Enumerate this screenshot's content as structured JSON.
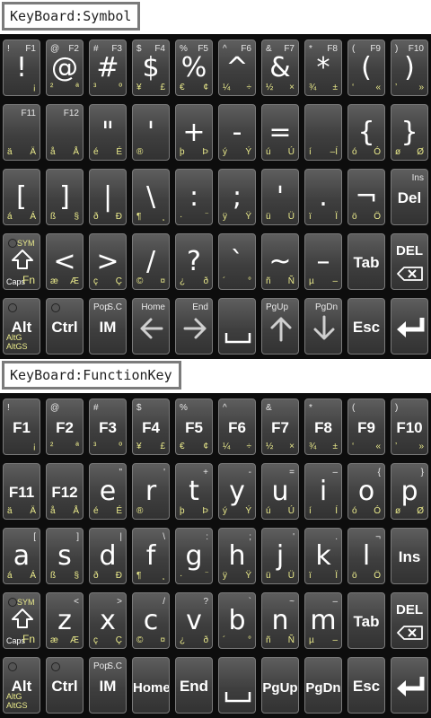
{
  "captions": {
    "symbol": "KeyBoard:Symbol",
    "function": "KeyBoard:FunctionKey"
  },
  "symbol_keyboard": {
    "row1": [
      {
        "tl": "!",
        "tr": "F1",
        "main": "!",
        "bl": "",
        "br": "¡"
      },
      {
        "tl": "@",
        "tr": "F2",
        "main": "@",
        "bl": "²",
        "br": "ª"
      },
      {
        "tl": "#",
        "tr": "F3",
        "main": "#",
        "bl": "³",
        "br": "º"
      },
      {
        "tl": "$",
        "tr": "F4",
        "main": "$",
        "bl": "¥",
        "br": "£"
      },
      {
        "tl": "%",
        "tr": "F5",
        "main": "%",
        "bl": "€",
        "br": "¢"
      },
      {
        "tl": "^",
        "tr": "F6",
        "main": "^",
        "bl": "¼",
        "br": "÷"
      },
      {
        "tl": "&",
        "tr": "F7",
        "main": "&",
        "bl": "½",
        "br": "×"
      },
      {
        "tl": "*",
        "tr": "F8",
        "main": "*",
        "bl": "¾",
        "br": "±"
      },
      {
        "tl": "(",
        "tr": "F9",
        "main": "(",
        "bl": "‘",
        "br": "«"
      },
      {
        "tl": ")",
        "tr": "F10",
        "main": ")",
        "bl": "’",
        "br": "»"
      }
    ],
    "row2": [
      {
        "tl": "",
        "tr": "F11",
        "main": "",
        "bl": "ä",
        "br": "Ä"
      },
      {
        "tl": "",
        "tr": "F12",
        "main": "",
        "bl": "å",
        "br": "Å"
      },
      {
        "tl": "",
        "tr": "",
        "main": "\"",
        "bl": "é",
        "br": "É"
      },
      {
        "tl": "",
        "tr": "",
        "main": "'",
        "bl": "®",
        "br": ""
      },
      {
        "tl": "",
        "tr": "",
        "main": "+",
        "bl": "þ",
        "br": "Þ"
      },
      {
        "tl": "",
        "tr": "",
        "main": "-",
        "bl": "ý",
        "br": "Ý"
      },
      {
        "tl": "",
        "tr": "",
        "main": "=",
        "bl": "ú",
        "br": "Ú"
      },
      {
        "tl": "",
        "tr": "",
        "main": "",
        "bl": "í",
        "br": "–Í"
      },
      {
        "tl": "",
        "tr": "",
        "main": "{",
        "bl": "ó",
        "br": "Ó"
      },
      {
        "tl": "",
        "tr": "",
        "main": "}",
        "bl": "ø",
        "br": "Ø"
      }
    ],
    "row3": [
      {
        "tl": "",
        "tr": "",
        "main": "[",
        "bl": "á",
        "br": "Á"
      },
      {
        "tl": "",
        "tr": "",
        "main": "]",
        "bl": "ß",
        "br": "§"
      },
      {
        "tl": "",
        "tr": "",
        "main": "|",
        "bl": "ð",
        "br": "Ð"
      },
      {
        "tl": "",
        "tr": "",
        "main": "\\",
        "bl": "¶",
        "br": "¸"
      },
      {
        "tl": "",
        "tr": "",
        "main": ":",
        "bl": "·",
        "br": "¨"
      },
      {
        "tl": "",
        "tr": "",
        "main": ";",
        "bl": "ÿ",
        "br": "Ÿ"
      },
      {
        "tl": "",
        "tr": "",
        "main": "'",
        "bl": "ü",
        "br": "Ü"
      },
      {
        "tl": "",
        "tr": "",
        "main": ".",
        "bl": "ï",
        "br": "Ï"
      },
      {
        "tl": "",
        "tr": "",
        "main": "¬",
        "bl": "ö",
        "br": "Ö"
      },
      {
        "tl": "",
        "tr": "Ins",
        "main": "Del",
        "bl": "",
        "br": "",
        "word": true
      }
    ],
    "row4": [
      {
        "shift": true,
        "sym": "SYM",
        "caps": "Caps",
        "fn": "Fn"
      },
      {
        "tl": "",
        "tr": "",
        "main": "<",
        "bl": "æ",
        "br": "Æ"
      },
      {
        "tl": "",
        "tr": "",
        "main": ">",
        "bl": "ç",
        "br": "Ç"
      },
      {
        "tl": "",
        "tr": "",
        "main": "/",
        "bl": "©",
        "br": "¤"
      },
      {
        "tl": "",
        "tr": "",
        "main": "?",
        "bl": "¿",
        "br": "ð"
      },
      {
        "tl": "",
        "tr": "",
        "main": "`",
        "bl": "´",
        "br": "°"
      },
      {
        "tl": "",
        "tr": "",
        "main": "~",
        "bl": "ñ",
        "br": "Ñ"
      },
      {
        "tl": "",
        "tr": "",
        "main": "–",
        "bl": "µ",
        "br": "–"
      },
      {
        "tl": "",
        "tr": "",
        "main": "Tab",
        "bl": "",
        "br": "",
        "word": true
      },
      {
        "del_icon": true,
        "main": "DEL"
      }
    ],
    "row5": [
      {
        "main": "Alt",
        "word": true,
        "led": true,
        "altg": "AltG AltGS"
      },
      {
        "main": "Ctrl",
        "word": true,
        "led": true
      },
      {
        "main": "IM",
        "word": true,
        "tl": "Pop",
        "tr": "S.C"
      },
      {
        "arrow": "left",
        "tr": "Home"
      },
      {
        "arrow": "right",
        "tr": "End"
      },
      {
        "space": true
      },
      {
        "arrow": "up",
        "tl": "PgUp"
      },
      {
        "arrow": "down",
        "tr": "PgDn"
      },
      {
        "main": "Esc",
        "word": true
      },
      {
        "enter": true
      }
    ]
  },
  "function_keyboard": {
    "row1": [
      {
        "tl": "!",
        "tr": "",
        "main": "F1",
        "bl": "",
        "br": "¡",
        "word": true
      },
      {
        "tl": "@",
        "tr": "",
        "main": "F2",
        "bl": "²",
        "br": "ª",
        "word": true
      },
      {
        "tl": "#",
        "tr": "",
        "main": "F3",
        "bl": "³",
        "br": "º",
        "word": true
      },
      {
        "tl": "$",
        "tr": "",
        "main": "F4",
        "bl": "¥",
        "br": "£",
        "word": true
      },
      {
        "tl": "%",
        "tr": "",
        "main": "F5",
        "bl": "€",
        "br": "¢",
        "word": true
      },
      {
        "tl": "^",
        "tr": "",
        "main": "F6",
        "bl": "¼",
        "br": "÷",
        "word": true
      },
      {
        "tl": "&",
        "tr": "",
        "main": "F7",
        "bl": "½",
        "br": "×",
        "word": true
      },
      {
        "tl": "*",
        "tr": "",
        "main": "F8",
        "bl": "¾",
        "br": "±",
        "word": true
      },
      {
        "tl": "(",
        "tr": "",
        "main": "F9",
        "bl": "‘",
        "br": "«",
        "word": true
      },
      {
        "tl": ")",
        "tr": "",
        "main": "F10",
        "bl": "’",
        "br": "»",
        "word": true
      }
    ],
    "row2": [
      {
        "tl": "",
        "tr": "",
        "main": "F11",
        "bl": "ä",
        "br": "Ä",
        "word": true
      },
      {
        "tl": "",
        "tr": "",
        "main": "F12",
        "bl": "å",
        "br": "Å",
        "word": true
      },
      {
        "tl": "",
        "tr": "\"",
        "main": "e",
        "bl": "é",
        "br": "É"
      },
      {
        "tl": "",
        "tr": "'",
        "main": "r",
        "bl": "®",
        "br": ""
      },
      {
        "tl": "",
        "tr": "+",
        "main": "t",
        "bl": "þ",
        "br": "Þ"
      },
      {
        "tl": "",
        "tr": "-",
        "main": "y",
        "bl": "ý",
        "br": "Ý"
      },
      {
        "tl": "",
        "tr": "=",
        "main": "u",
        "bl": "ú",
        "br": "Ú"
      },
      {
        "tl": "",
        "tr": "–",
        "main": "i",
        "bl": "í",
        "br": "Í"
      },
      {
        "tl": "",
        "tr": "{",
        "main": "o",
        "bl": "ó",
        "br": "Ó"
      },
      {
        "tl": "",
        "tr": "}",
        "main": "p",
        "bl": "ø",
        "br": "Ø"
      }
    ],
    "row3": [
      {
        "tl": "",
        "tr": "[",
        "main": "a",
        "bl": "á",
        "br": "Á"
      },
      {
        "tl": "",
        "tr": "]",
        "main": "s",
        "bl": "ß",
        "br": "§"
      },
      {
        "tl": "",
        "tr": "|",
        "main": "d",
        "bl": "ð",
        "br": "Ð"
      },
      {
        "tl": "",
        "tr": "\\",
        "main": "f",
        "bl": "¶",
        "br": "¸"
      },
      {
        "tl": "",
        "tr": ":",
        "main": "g",
        "bl": "·",
        "br": "¨"
      },
      {
        "tl": "",
        "tr": ";",
        "main": "h",
        "bl": "ÿ",
        "br": "Ÿ"
      },
      {
        "tl": "",
        "tr": "'",
        "main": "j",
        "bl": "ü",
        "br": "Ü"
      },
      {
        "tl": "",
        "tr": ".",
        "main": "k",
        "bl": "ï",
        "br": "Ï"
      },
      {
        "tl": "",
        "tr": "¬",
        "main": "l",
        "bl": "ö",
        "br": "Ö"
      },
      {
        "tl": "",
        "tr": "",
        "main": "Ins",
        "bl": "",
        "br": "",
        "word": true
      }
    ],
    "row4": [
      {
        "shift": true,
        "sym": "SYM",
        "caps": "Caps",
        "fn": "Fn"
      },
      {
        "tl": "",
        "tr": "<",
        "main": "z",
        "bl": "æ",
        "br": "Æ"
      },
      {
        "tl": "",
        "tr": ">",
        "main": "x",
        "bl": "ç",
        "br": "Ç"
      },
      {
        "tl": "",
        "tr": "/",
        "main": "c",
        "bl": "©",
        "br": "¤"
      },
      {
        "tl": "",
        "tr": "?",
        "main": "v",
        "bl": "¿",
        "br": "ð"
      },
      {
        "tl": "",
        "tr": "`",
        "main": "b",
        "bl": "´",
        "br": "°"
      },
      {
        "tl": "",
        "tr": "~",
        "main": "n",
        "bl": "ñ",
        "br": "Ñ"
      },
      {
        "tl": "",
        "tr": "–",
        "main": "m",
        "bl": "µ",
        "br": "–"
      },
      {
        "tl": "",
        "tr": "",
        "main": "Tab",
        "bl": "",
        "br": "",
        "word": true
      },
      {
        "del_icon": true,
        "main": "DEL"
      }
    ],
    "row5": [
      {
        "main": "Alt",
        "word": true,
        "led": true,
        "altg": "AltG AltGS"
      },
      {
        "main": "Ctrl",
        "word": true,
        "led": true
      },
      {
        "main": "IM",
        "word": true,
        "tl": "Pop",
        "tr": "S.C"
      },
      {
        "main": "Home",
        "word": true,
        "small": true
      },
      {
        "main": "End",
        "word": true
      },
      {
        "space": true
      },
      {
        "main": "PgUp",
        "word": true,
        "small": true
      },
      {
        "main": "PgDn",
        "word": true,
        "small": true
      },
      {
        "main": "Esc",
        "word": true
      },
      {
        "enter": true
      }
    ]
  }
}
